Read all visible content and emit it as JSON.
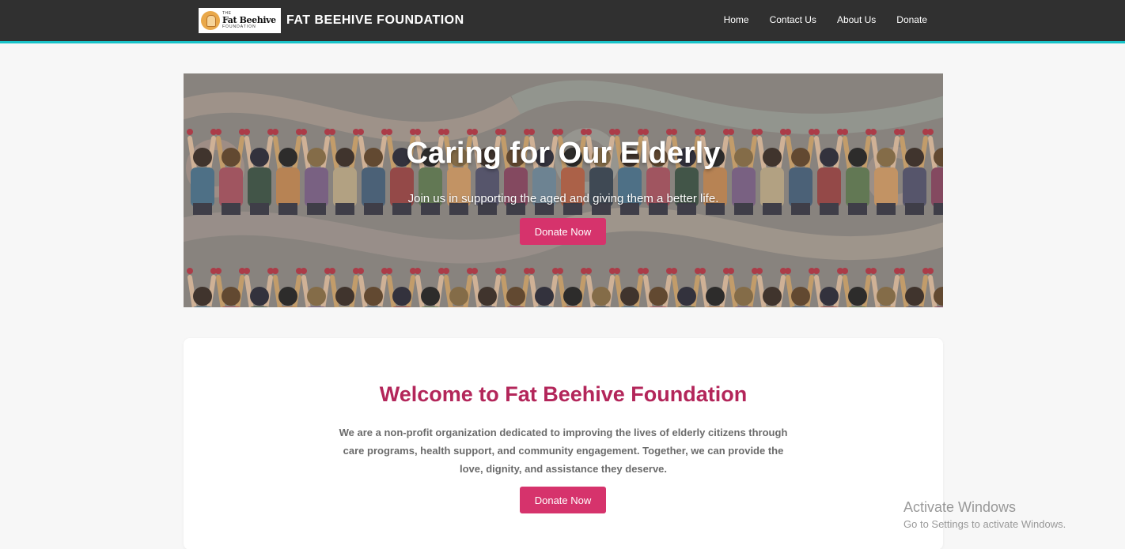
{
  "nav": {
    "logo_small": "THE",
    "logo_name": "Fat Beehive",
    "logo_sub": "FOUNDATION",
    "title": "FAT BEEHIVE FOUNDATION",
    "links": [
      "Home",
      "Contact Us",
      "About Us",
      "Donate"
    ]
  },
  "hero": {
    "title": "Caring for Our Elderly",
    "subtitle": "Join us in supporting the aged and giving them a better life.",
    "button": "Donate Now"
  },
  "welcome": {
    "title": "Welcome to Fat Beehive Foundation",
    "text": "We are a non-profit organization dedicated to improving the lives of elderly citizens through care programs, health support, and community engagement. Together, we can provide the love, dignity, and assistance they deserve.",
    "button": "Donate Now"
  },
  "watermark": {
    "title": "Activate Windows",
    "subtitle": "Go to Settings to activate Windows."
  },
  "colors": {
    "navbar": "#303030",
    "navbar_accent": "#19c3c9",
    "button": "#d6336c",
    "welcome_title": "#b3265a"
  }
}
